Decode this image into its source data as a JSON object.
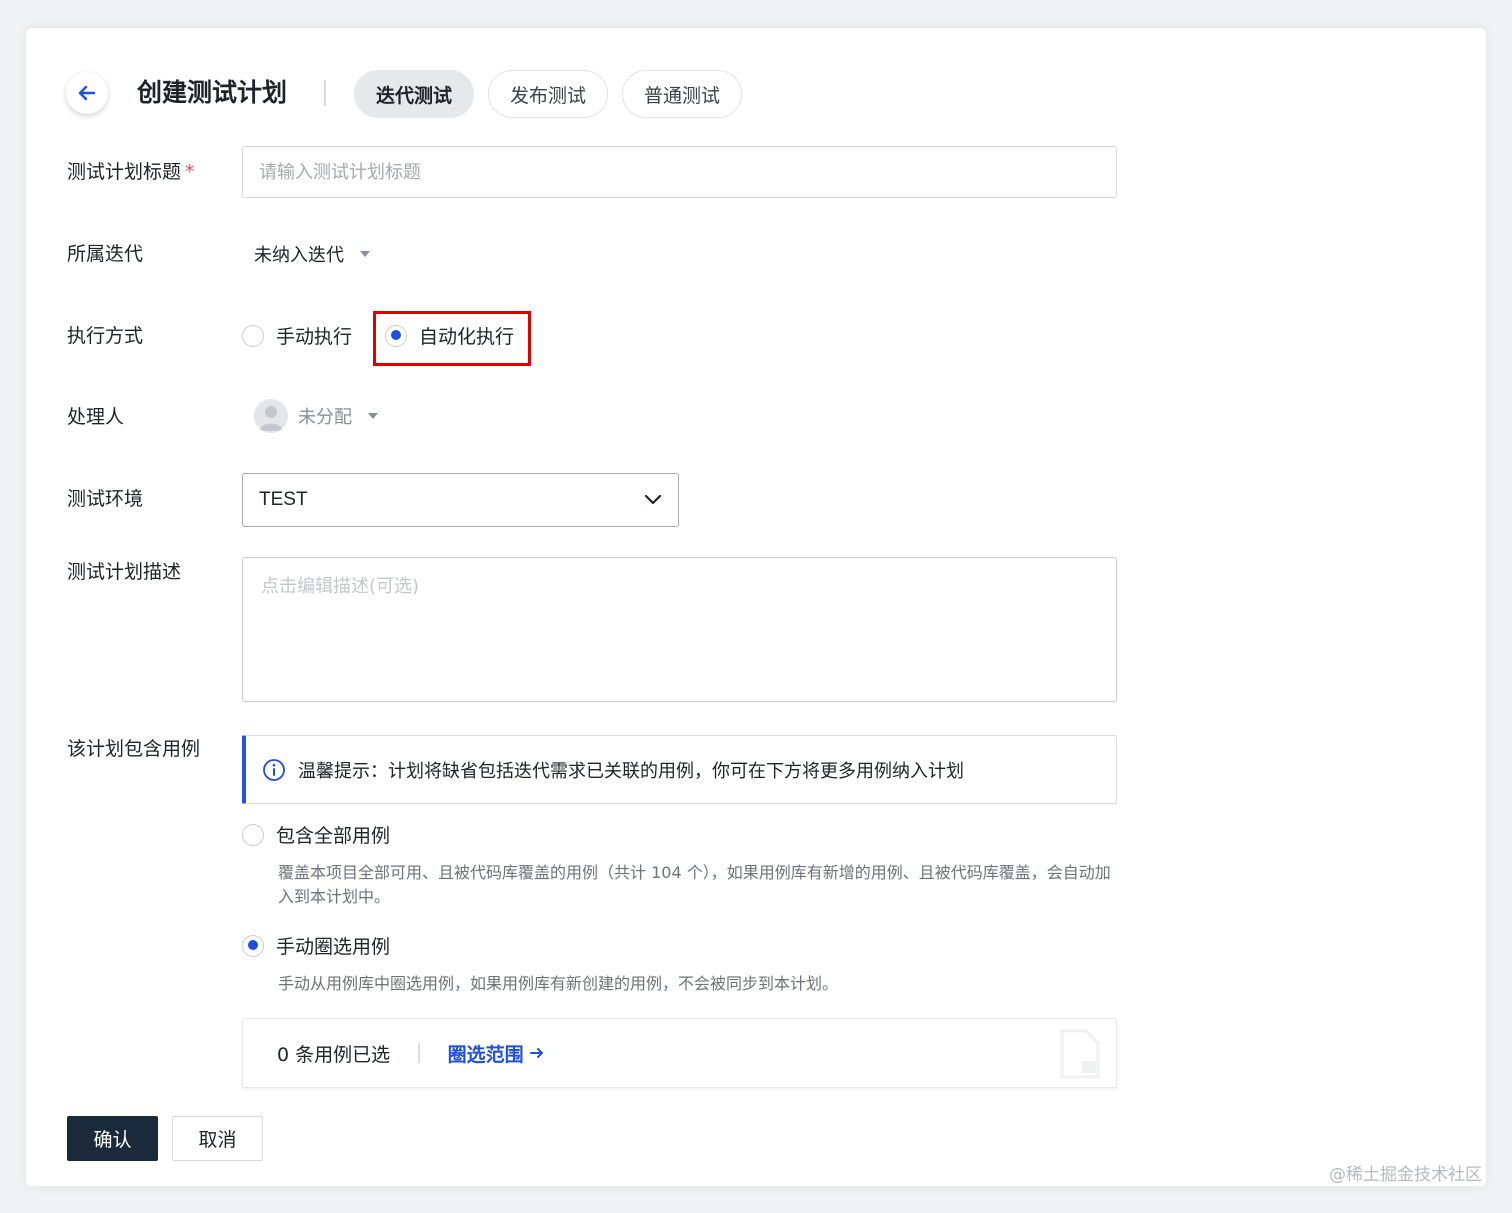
{
  "header": {
    "title": "创建测试计划",
    "tabs": [
      {
        "label": "迭代测试",
        "active": true
      },
      {
        "label": "发布测试",
        "active": false
      },
      {
        "label": "普通测试",
        "active": false
      }
    ]
  },
  "form": {
    "title_field": {
      "label": "测试计划标题",
      "required_mark": "*",
      "placeholder": "请输入测试计划标题"
    },
    "iteration": {
      "label": "所属迭代",
      "value": "未纳入迭代"
    },
    "execution": {
      "label": "执行方式",
      "options": [
        {
          "label": "手动执行",
          "checked": false
        },
        {
          "label": "自动化执行",
          "checked": true
        }
      ]
    },
    "assignee": {
      "label": "处理人",
      "value": "未分配"
    },
    "environment": {
      "label": "测试环境",
      "value": "TEST"
    },
    "description": {
      "label": "测试计划描述",
      "placeholder": "点击编辑描述(可选)"
    },
    "cases": {
      "label": "该计划包含用例",
      "tip": "温馨提示：计划将缺省包括迭代需求已关联的用例，你可在下方将更多用例纳入计划",
      "options": [
        {
          "label": "包含全部用例",
          "checked": false,
          "desc": "覆盖本项目全部可用、且被代码库覆盖的用例（共计 104 个），如果用例库有新增的用例、且被代码库覆盖，会自动加入到本计划中。"
        },
        {
          "label": "手动圈选用例",
          "checked": true,
          "desc": "手动从用例库中圈选用例，如果用例库有新创建的用例，不会被同步到本计划。"
        }
      ],
      "selected_count": "0 条用例已选",
      "scope_link": "圈选范围"
    }
  },
  "actions": {
    "confirm": "确认",
    "cancel": "取消"
  },
  "watermark": "@稀土掘金技术社区",
  "colors": {
    "accent": "#1f4fe0",
    "primary_button": "#1b2a3a",
    "highlight": "#e00000",
    "required": "#e34d59"
  }
}
